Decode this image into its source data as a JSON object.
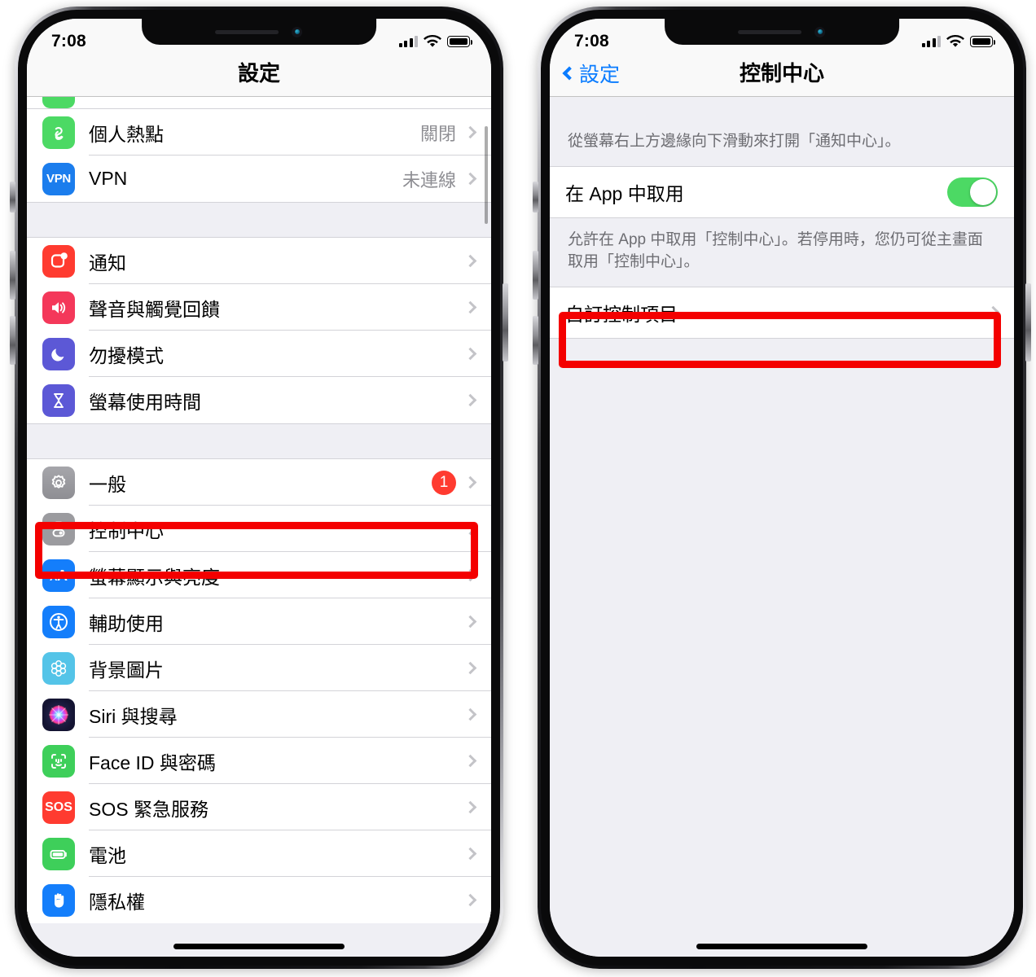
{
  "meta": {
    "accent_blue": "#0a7cff",
    "annotation_red": "#f40000",
    "toggle_green": "#4cd964",
    "badge_red": "#ff3b30"
  },
  "phone1": {
    "status": {
      "time": "7:08",
      "signal_icon": "cellular-bars-icon",
      "wifi_icon": "wifi-icon",
      "battery_icon": "battery-icon"
    },
    "nav": {
      "title": "設定"
    },
    "sections": [
      {
        "rows": [
          {
            "icon": "hotspot-icon",
            "label": "個人熱點",
            "value": "關閉",
            "chevron": true
          },
          {
            "icon": "vpn-icon",
            "label": "VPN",
            "value": "未連線",
            "chevron": true
          }
        ]
      },
      {
        "rows": [
          {
            "icon": "notifications-icon",
            "label": "通知",
            "value": "",
            "chevron": true
          },
          {
            "icon": "sounds-haptics-icon",
            "label": "聲音與觸覺回饋",
            "value": "",
            "chevron": true
          },
          {
            "icon": "do-not-disturb-icon",
            "label": "勿擾模式",
            "value": "",
            "chevron": true
          },
          {
            "icon": "screen-time-icon",
            "label": "螢幕使用時間",
            "value": "",
            "chevron": true
          }
        ]
      },
      {
        "rows": [
          {
            "icon": "general-gear-icon",
            "label": "一般",
            "value": "",
            "badge": "1",
            "chevron": true
          },
          {
            "icon": "control-center-icon",
            "label": "控制中心",
            "value": "",
            "chevron": true,
            "highlighted": true
          },
          {
            "icon": "display-brightness-icon",
            "label": "螢幕顯示與亮度",
            "value": "",
            "chevron": true
          },
          {
            "icon": "accessibility-icon",
            "label": "輔助使用",
            "value": "",
            "chevron": true
          },
          {
            "icon": "wallpaper-icon",
            "label": "背景圖片",
            "value": "",
            "chevron": true
          },
          {
            "icon": "siri-icon",
            "label": "Siri 與搜尋",
            "value": "",
            "chevron": true
          },
          {
            "icon": "face-id-icon",
            "label": "Face ID 與密碼",
            "value": "",
            "chevron": true
          },
          {
            "icon": "sos-icon",
            "label": "SOS 緊急服務",
            "value": "",
            "chevron": true
          },
          {
            "icon": "battery-settings-icon",
            "label": "電池",
            "value": "",
            "chevron": true
          },
          {
            "icon": "privacy-hand-icon",
            "label": "隱私權",
            "value": "",
            "chevron": true
          }
        ]
      }
    ]
  },
  "phone2": {
    "status": {
      "time": "7:08",
      "signal_icon": "cellular-bars-icon",
      "wifi_icon": "wifi-icon",
      "battery_icon": "battery-icon"
    },
    "nav": {
      "back_label": "設定",
      "title": "控制中心"
    },
    "header_note": "從螢幕右上方邊緣向下滑動來打開「通知中心」。",
    "toggle_row": {
      "label": "在 App 中取用",
      "state": "on"
    },
    "footer_note": "允許在 App 中取用「控制中心」。若停用時，您仍可從主畫面取用「控制中心」。",
    "customize_row": {
      "label": "自訂控制項目",
      "chevron": true,
      "highlighted": true
    }
  }
}
